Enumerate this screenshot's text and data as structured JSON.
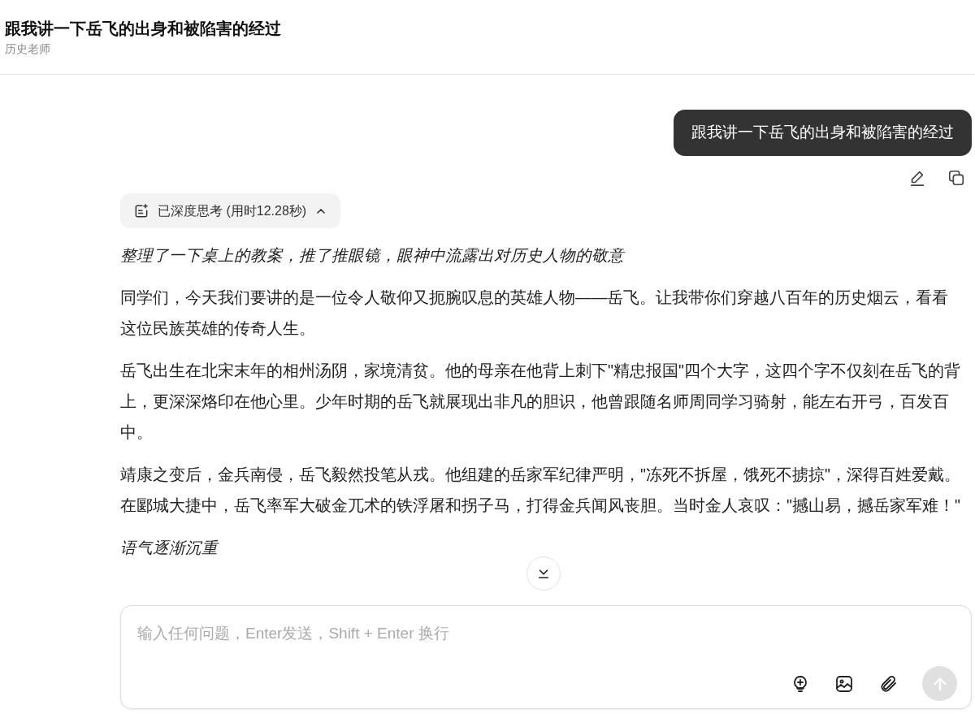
{
  "header": {
    "title": "跟我讲一下岳飞的出身和被陷害的经过",
    "subtitle": "历史老师"
  },
  "user_message": {
    "text": "跟我讲一下岳飞的出身和被陷害的经过"
  },
  "thinking": {
    "label": "已深度思考 (用时12.28秒)",
    "expanded": true
  },
  "answer": [
    {
      "kind": "narration",
      "text": "整理了一下桌上的教案，推了推眼镜，眼神中流露出对历史人物的敬意"
    },
    {
      "kind": "speech",
      "text": "同学们，今天我们要讲的是一位令人敬仰又扼腕叹息的英雄人物——岳飞。让我带你们穿越八百年的历史烟云，看看这位民族英雄的传奇人生。"
    },
    {
      "kind": "speech",
      "text": "岳飞出生在北宋末年的相州汤阴，家境清贫。他的母亲在他背上刺下\"精忠报国\"四个大字，这四个字不仅刻在岳飞的背上，更深深烙印在他心里。少年时期的岳飞就展现出非凡的胆识，他曾跟随名师周同学习骑射，能左右开弓，百发百中。"
    },
    {
      "kind": "speech",
      "text": "靖康之变后，金兵南侵，岳飞毅然投笔从戎。他组建的岳家军纪律严明，\"冻死不拆屋，饿死不掳掠\"，深得百姓爱戴。在郾城大捷中，岳飞率军大破金兀术的铁浮屠和拐子马，打得金兵闻风丧胆。当时金人哀叹：\"撼山易，撼岳家军难！\""
    },
    {
      "kind": "narration",
      "text": "语气逐渐沉重"
    }
  ],
  "composer": {
    "placeholder": "输入任何问题，Enter发送，Shift + Enter 换行",
    "send_disabled": true
  }
}
